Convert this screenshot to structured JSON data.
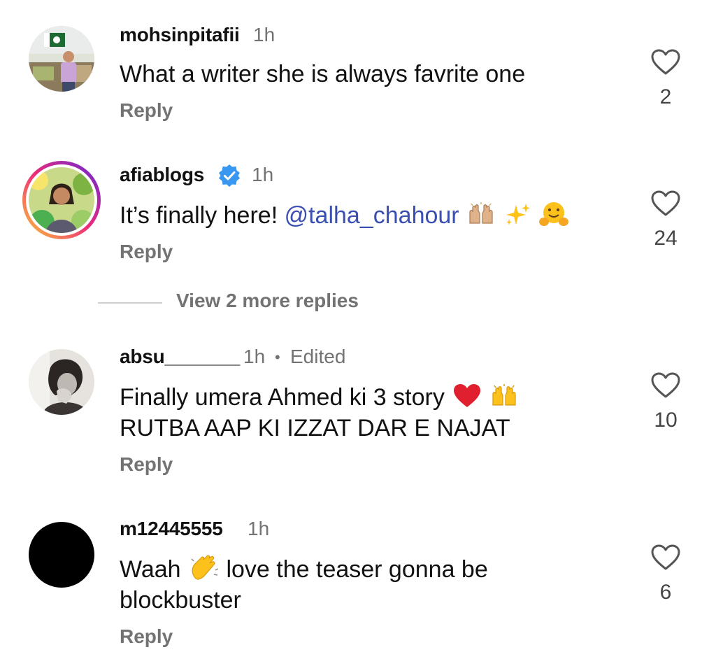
{
  "comments": [
    {
      "username": "mohsinpitafii",
      "time": "1h",
      "edited": "",
      "text_lines": [
        "What a writer she is always favrite one"
      ],
      "reply_label": "Reply",
      "likes": "2",
      "avatar_icon": "profile-photo-man-flag"
    },
    {
      "username": "afiablogs",
      "verified": true,
      "time": "1h",
      "text_prefix": "It’s finally here! ",
      "mention": "@talha_chahour",
      "emojis": [
        "raising-hands-icon",
        "sparkles-icon",
        "hugging-face-icon"
      ],
      "reply_label": "Reply",
      "likes": "24",
      "avatar_icon": "profile-photo-woman-story-ring"
    },
    {
      "username": "absu_______",
      "time": "1h",
      "separator": "•",
      "edited": "Edited",
      "text_lines": [
        "Finally umera Ahmed ki 3 story",
        "RUTBA AAP KI IZZAT DAR E NAJAT"
      ],
      "emojis": [
        "red-heart-icon",
        "raising-hands-icon"
      ],
      "reply_label": "Reply",
      "likes": "10",
      "avatar_icon": "profile-photo-grayscale"
    },
    {
      "username": "m12445555",
      "time": "1h",
      "text_before_emoji": "Waah",
      "emoji": "clapping-hands-icon",
      "text_after_emoji": " love the teaser gonna be",
      "text_line2": "blockbuster",
      "reply_label": "Reply",
      "likes": "6",
      "avatar_icon": "profile-photo-black"
    }
  ],
  "view_more_replies": "View 2 more replies",
  "colors": {
    "text": "#111111",
    "muted": "#737373",
    "mention": "#3b4fb0",
    "verified": "#3897f0",
    "story_ring_start": "#f9ce34",
    "story_ring_end": "#ee2a7b"
  }
}
